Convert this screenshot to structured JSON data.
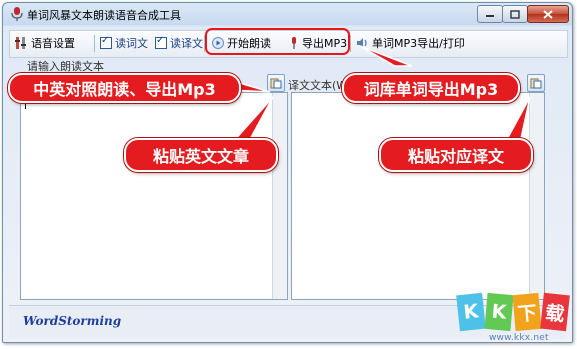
{
  "window": {
    "title": "单词风暴文本朗读语音合成工具",
    "controls": {
      "minimize": "—",
      "maximize": "▭",
      "close": "✕"
    }
  },
  "toolbar": {
    "voice_settings": "语音设置",
    "read_source": "读词文",
    "read_translation": "读译文",
    "start_reading": "开始朗读",
    "export_mp3": "导出MP3",
    "word_export": "单词MP3导出/打印"
  },
  "left_panel": {
    "label": "请输入朗读文本",
    "text": ""
  },
  "right_panel": {
    "label": "译文文本(W):",
    "text": ""
  },
  "status": {
    "brand": "WordStorming"
  },
  "annotations": {
    "cn_en_export": "中英对照朗读、导出Mp3",
    "word_lib_export": "词库单词导出Mp3",
    "paste_english": "粘贴英文文章",
    "paste_translation": "粘贴对应译文"
  },
  "watermark": {
    "letters": [
      "K",
      "K",
      "下",
      "载"
    ],
    "url": "www.kkx.net"
  },
  "colors": {
    "callout_red": "#e41b1f",
    "highlight_red": "#e8171b",
    "brand_blue": "#1d3f9c"
  }
}
